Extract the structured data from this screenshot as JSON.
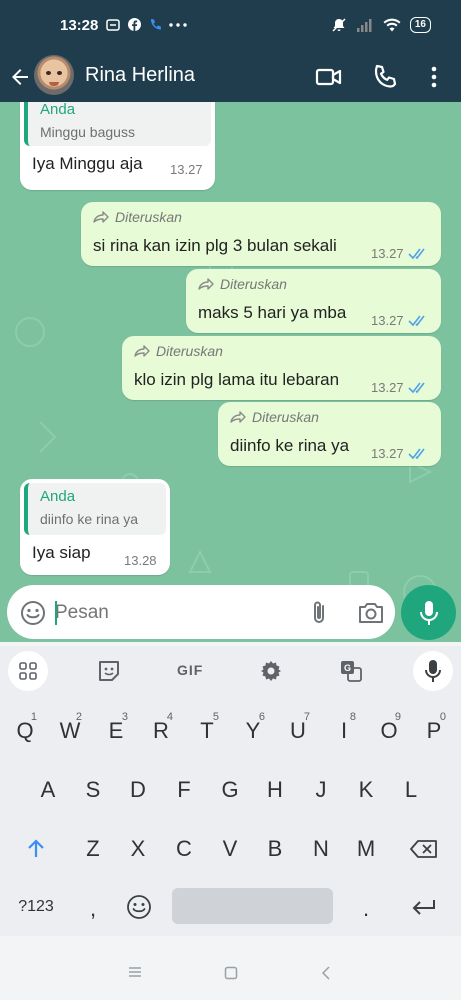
{
  "status_bar": {
    "time": "13:28",
    "battery": "16"
  },
  "header": {
    "contact_name": "Rina Herlina"
  },
  "messages": [
    {
      "direction": "in",
      "quote_author": "Anda",
      "quote_text": "Minggu baguss",
      "text": "Iya Minggu aja",
      "time": "13.27"
    },
    {
      "direction": "out",
      "forwarded": "Diteruskan",
      "text": "si rina kan izin plg 3 bulan sekali",
      "time": "13.27"
    },
    {
      "direction": "out",
      "forwarded": "Diteruskan",
      "text": "maks 5 hari ya mba",
      "time": "13.27"
    },
    {
      "direction": "out",
      "forwarded": "Diteruskan",
      "text": "klo izin plg lama itu lebaran",
      "time": "13.27"
    },
    {
      "direction": "out",
      "forwarded": "Diteruskan",
      "text": "diinfo ke rina ya",
      "time": "13.27"
    },
    {
      "direction": "in",
      "quote_author": "Anda",
      "quote_text": "diinfo ke rina ya",
      "text": "Iya siap",
      "time": "13.28"
    }
  ],
  "input": {
    "placeholder": "Pesan"
  },
  "keyboard": {
    "toolbar_gif": "GIF",
    "row1": [
      {
        "key": "Q",
        "hint": "1"
      },
      {
        "key": "W",
        "hint": "2"
      },
      {
        "key": "E",
        "hint": "3"
      },
      {
        "key": "R",
        "hint": "4"
      },
      {
        "key": "T",
        "hint": "5"
      },
      {
        "key": "Y",
        "hint": "6"
      },
      {
        "key": "U",
        "hint": "7"
      },
      {
        "key": "I",
        "hint": "8"
      },
      {
        "key": "O",
        "hint": "9"
      },
      {
        "key": "P",
        "hint": "0"
      }
    ],
    "row2": [
      "A",
      "S",
      "D",
      "F",
      "G",
      "H",
      "J",
      "K",
      "L"
    ],
    "row3": [
      "Z",
      "X",
      "C",
      "V",
      "B",
      "N",
      "M"
    ],
    "symbols_key": "?123",
    "comma_key": ",",
    "period_key": "."
  },
  "colors": {
    "header_bg": "#1f3d4c",
    "chat_bg": "#7dc29e",
    "outgoing_bubble": "#e7fbd6",
    "accent": "#1fa67c",
    "read_ticks": "#4fa3e6"
  },
  "icons": [
    "back-arrow-icon",
    "video-call-icon",
    "phone-icon",
    "more-vert-icon",
    "forward-icon",
    "double-check-icon",
    "emoji-icon",
    "attach-icon",
    "camera-icon",
    "mic-icon",
    "apps-grid-icon",
    "sticker-icon",
    "gif-icon",
    "settings-icon",
    "translate-icon",
    "shift-icon",
    "backspace-icon",
    "enter-icon"
  ]
}
